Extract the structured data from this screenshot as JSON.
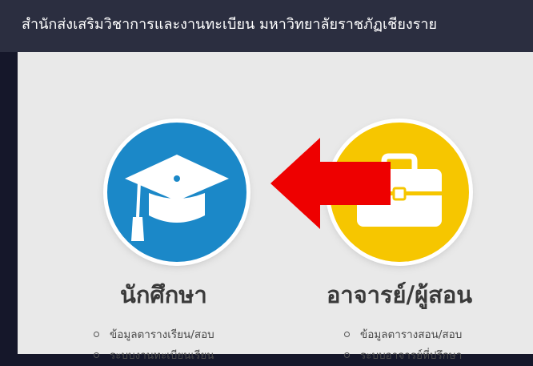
{
  "header": {
    "title": "สำนักส่งเสริมวิชาการและงานทะเบียน มหาวิทยาลัยราชภัฏเชียงราย"
  },
  "cards": {
    "student": {
      "icon": "graduation-cap-icon",
      "color": "#1b88c8",
      "heading": "นักศึกษา",
      "links": [
        "ข้อมูลตารางเรียน/สอบ",
        "ระบบงานทะเบียนเรียน"
      ]
    },
    "teacher": {
      "icon": "briefcase-icon",
      "color": "#f6c600",
      "heading": "อาจารย์/ผู้สอน",
      "links": [
        "ข้อมูลตารางสอน/สอบ",
        "ระบบอาจารย์ที่ปรึกษา"
      ]
    }
  },
  "annotation": {
    "icon": "red-arrow-left-icon",
    "color": "#ee0000"
  }
}
